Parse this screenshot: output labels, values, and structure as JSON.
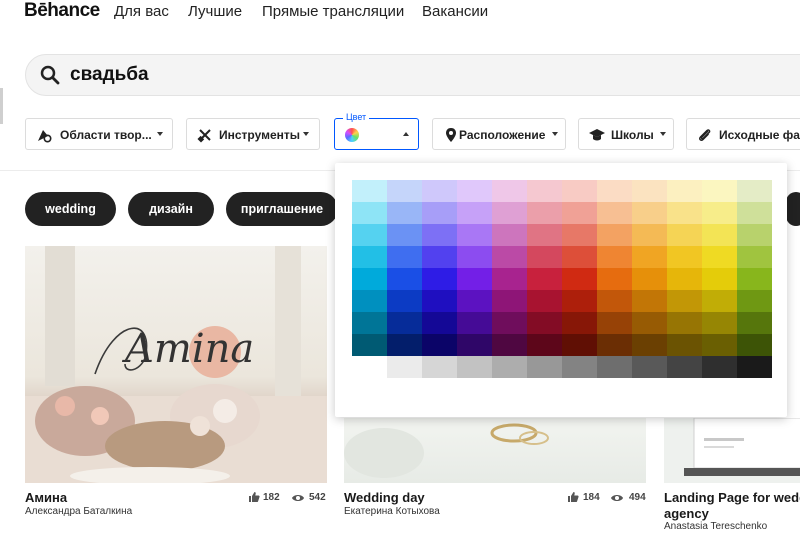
{
  "nav": {
    "logo": "Bēhance",
    "links": [
      "Для вас",
      "Лучшие",
      "Прямые трансляции",
      "Вакансии"
    ]
  },
  "search": {
    "query": "свадьба"
  },
  "filters": {
    "creative_fields": "Области твор...",
    "tools": "Инструменты",
    "color_legend": "Цвет",
    "location": "Расположение",
    "schools": "Школы",
    "source_files": "Исходные фа"
  },
  "tags": [
    "wedding",
    "дизайн",
    "приглашение"
  ],
  "cards": [
    {
      "title": "Амина",
      "author": "Александра Баталкина",
      "likes": "182",
      "views": "542",
      "overlay": "Amina"
    },
    {
      "title": "Wedding day",
      "author": "Екатерина Котыхова",
      "likes": "184",
      "views": "494"
    },
    {
      "title": "Landing Page for wedd",
      "title2": "agency",
      "author": "Anastasia Tereschenko"
    }
  ],
  "color_palette": {
    "columns": [
      [
        "#c2f0fb",
        "#8ee4f6",
        "#55d2f0",
        "#22bfe6",
        "#00aadb",
        "#0090bf",
        "#007597",
        "#005a73"
      ],
      [
        "#c5d5fa",
        "#99b6f7",
        "#6b92f4",
        "#3f6ef0",
        "#1a4fe6",
        "#0c3bc4",
        "#062c99",
        "#031e6b"
      ],
      [
        "#cfc8fb",
        "#a79ef8",
        "#7d70f5",
        "#5241ef",
        "#2e1ce6",
        "#1f0fc0",
        "#140896",
        "#0b0468"
      ],
      [
        "#e0c8fb",
        "#c6a1f8",
        "#a977f5",
        "#8c4cf0",
        "#731fe7",
        "#5c12c1",
        "#450b96",
        "#2f0668"
      ],
      [
        "#efc7e8",
        "#dfa0d4",
        "#cd75bd",
        "#bb4aa6",
        "#a8238f",
        "#8e1577",
        "#6f0d5c",
        "#4f0741"
      ],
      [
        "#f5c8d0",
        "#eb9faa",
        "#e07484",
        "#d4485e",
        "#c8213d",
        "#a81330",
        "#830c25",
        "#5d061a"
      ],
      [
        "#f8cbc4",
        "#f0a196",
        "#e77867",
        "#dd4f39",
        "#d02a12",
        "#ad1f0b",
        "#871707",
        "#600f04"
      ],
      [
        "#fbdcc4",
        "#f7bf93",
        "#f3a262",
        "#ef8532",
        "#e66c0f",
        "#c2570a",
        "#974206",
        "#6b2e04"
      ],
      [
        "#fbe3c0",
        "#f8cf8a",
        "#f4ba55",
        "#f0a523",
        "#e6900a",
        "#c27606",
        "#975b04",
        "#6b4002"
      ],
      [
        "#fcf0c0",
        "#f9e28a",
        "#f5d455",
        "#f1c623",
        "#e6b60a",
        "#c29706",
        "#977504",
        "#6b5302"
      ],
      [
        "#fbf6c0",
        "#f7ed8a",
        "#f3e455",
        "#efda23",
        "#e4cc0a",
        "#c1ad06",
        "#968604",
        "#6a5f02"
      ],
      [
        "#e4ecc6",
        "#cfe09a",
        "#b8d26c",
        "#a0c43f",
        "#88b61c",
        "#6f9813",
        "#56760c",
        "#3d5406"
      ]
    ],
    "grays": [
      "#ffffff",
      "#ebebeb",
      "#d6d6d6",
      "#c2c2c2",
      "#adadad",
      "#989898",
      "#838383",
      "#6e6e6e",
      "#595959",
      "#444444",
      "#2f2f2f",
      "#1a1a1a"
    ]
  }
}
